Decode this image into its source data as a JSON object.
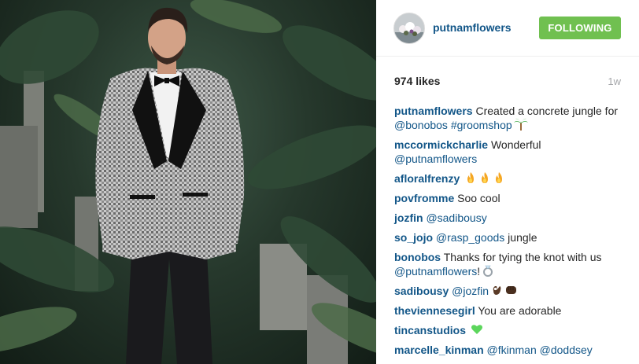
{
  "post": {
    "username": "putnamflowers",
    "follow_label": "FOLLOWING",
    "likes": "974 likes",
    "time": "1w"
  },
  "comments": [
    {
      "user": "putnamflowers",
      "parts": [
        {
          "t": "text",
          "v": " Created a concrete jungle for "
        },
        {
          "t": "mention",
          "v": "@bonobos"
        },
        {
          "t": "text",
          "v": " "
        },
        {
          "t": "mention",
          "v": "#groomshop"
        }
      ],
      "emojis": [
        "palm-tree"
      ]
    },
    {
      "user": "mccormickcharlie",
      "parts": [
        {
          "t": "text",
          "v": " Wonderful "
        },
        {
          "t": "mention",
          "v": "@putnamflowers"
        }
      ],
      "emojis": []
    },
    {
      "user": "afloralfrenzy",
      "parts": [
        {
          "t": "text",
          "v": " "
        }
      ],
      "emojis": [
        "fire",
        "fire",
        "fire"
      ]
    },
    {
      "user": "povfromme",
      "parts": [
        {
          "t": "text",
          "v": " Soo cool"
        }
      ],
      "emojis": []
    },
    {
      "user": "jozfin",
      "parts": [
        {
          "t": "text",
          "v": " "
        },
        {
          "t": "mention",
          "v": "@sadibousy"
        }
      ],
      "emojis": []
    },
    {
      "user": "so_jojo",
      "parts": [
        {
          "t": "text",
          "v": " "
        },
        {
          "t": "mention",
          "v": "@rasp_goods"
        },
        {
          "t": "text",
          "v": " jungle"
        }
      ],
      "emojis": []
    },
    {
      "user": "bonobos",
      "parts": [
        {
          "t": "text",
          "v": " Thanks for tying the knot with us "
        },
        {
          "t": "mention",
          "v": "@putnamflowers"
        },
        {
          "t": "text",
          "v": "!"
        }
      ],
      "emojis": [
        "ring"
      ]
    },
    {
      "user": "sadibousy",
      "parts": [
        {
          "t": "text",
          "v": " "
        },
        {
          "t": "mention",
          "v": "@jozfin"
        }
      ],
      "emojis": [
        "ok-hand",
        "fist"
      ]
    },
    {
      "user": "theviennesegirl",
      "parts": [
        {
          "t": "text",
          "v": " You are adorable"
        }
      ],
      "emojis": []
    },
    {
      "user": "tincanstudios",
      "parts": [
        {
          "t": "text",
          "v": " "
        }
      ],
      "emojis": [
        "green-heart"
      ]
    },
    {
      "user": "marcelle_kinman",
      "parts": [
        {
          "t": "text",
          "v": " "
        },
        {
          "t": "mention",
          "v": "@fkinman"
        },
        {
          "t": "text",
          "v": " "
        },
        {
          "t": "mention",
          "v": "@doddsey"
        }
      ],
      "emojis": []
    }
  ],
  "colors": {
    "link": "#125688",
    "follow_button": "#70c050",
    "time": "#a5a7aa"
  }
}
